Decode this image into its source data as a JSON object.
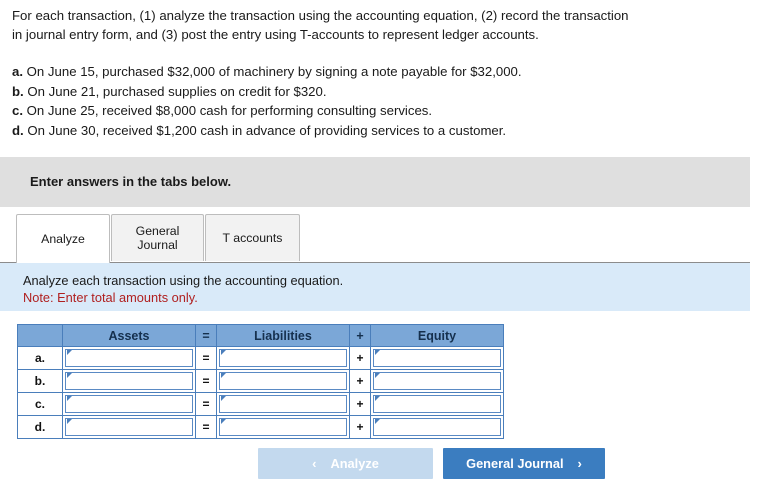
{
  "problem": {
    "intro_line_1": "For each transaction, (1) analyze the transaction using the accounting equation, (2) record the transaction",
    "intro_line_2": "in journal entry form, and (3) post the entry using T-accounts to represent ledger accounts.",
    "transactions": [
      {
        "letter": "a.",
        "text": "On June 15, purchased $32,000 of machinery by signing a note payable for $32,000."
      },
      {
        "letter": "b.",
        "text": "On June 21, purchased supplies on credit for $320."
      },
      {
        "letter": "c.",
        "text": "On June 25, received $8,000 cash for performing consulting services."
      },
      {
        "letter": "d.",
        "text": "On June 30, received $1,200 cash in advance of providing services to a customer."
      }
    ]
  },
  "banner": {
    "text": "Enter answers in the tabs below."
  },
  "tabs": [
    {
      "label": "Analyze",
      "active": true
    },
    {
      "label": "General Journal",
      "active": false
    },
    {
      "label": "T accounts",
      "active": false
    }
  ],
  "tab_labels": {
    "analyze": "Analyze",
    "general_journal_line1": "General",
    "general_journal_line2": "Journal",
    "t_accounts": "T accounts"
  },
  "instructions": {
    "main": "Analyze each transaction using the accounting equation.",
    "note": "Note: Enter total amounts only."
  },
  "table": {
    "headers": {
      "row_label": "",
      "assets": "Assets",
      "equals": "=",
      "liabilities": "Liabilities",
      "plus": "+",
      "equity": "Equity"
    },
    "rows": [
      {
        "label": "a.",
        "assets": "",
        "equals": "=",
        "liabilities": "",
        "plus": "+",
        "equity": ""
      },
      {
        "label": "b.",
        "assets": "",
        "equals": "=",
        "liabilities": "",
        "plus": "+",
        "equity": ""
      },
      {
        "label": "c.",
        "assets": "",
        "equals": "=",
        "liabilities": "",
        "plus": "+",
        "equity": ""
      },
      {
        "label": "d.",
        "assets": "",
        "equals": "=",
        "liabilities": "",
        "plus": "+",
        "equity": ""
      }
    ]
  },
  "nav": {
    "prev_label": "Analyze",
    "prev_icon": "chevron-left",
    "prev_chevron": "‹",
    "next_label": "General Journal",
    "next_icon": "chevron-right",
    "next_chevron": "›"
  },
  "colors": {
    "banner_gray": "#dfdfdf",
    "panel_light_blue": "#d9eaf9",
    "table_header_blue": "#7ba7d7",
    "table_border_blue": "#4a7ebb",
    "note_red": "#b02020",
    "button_primary_blue": "#3b7dc0",
    "button_disabled_blue": "#c3d9ee"
  }
}
